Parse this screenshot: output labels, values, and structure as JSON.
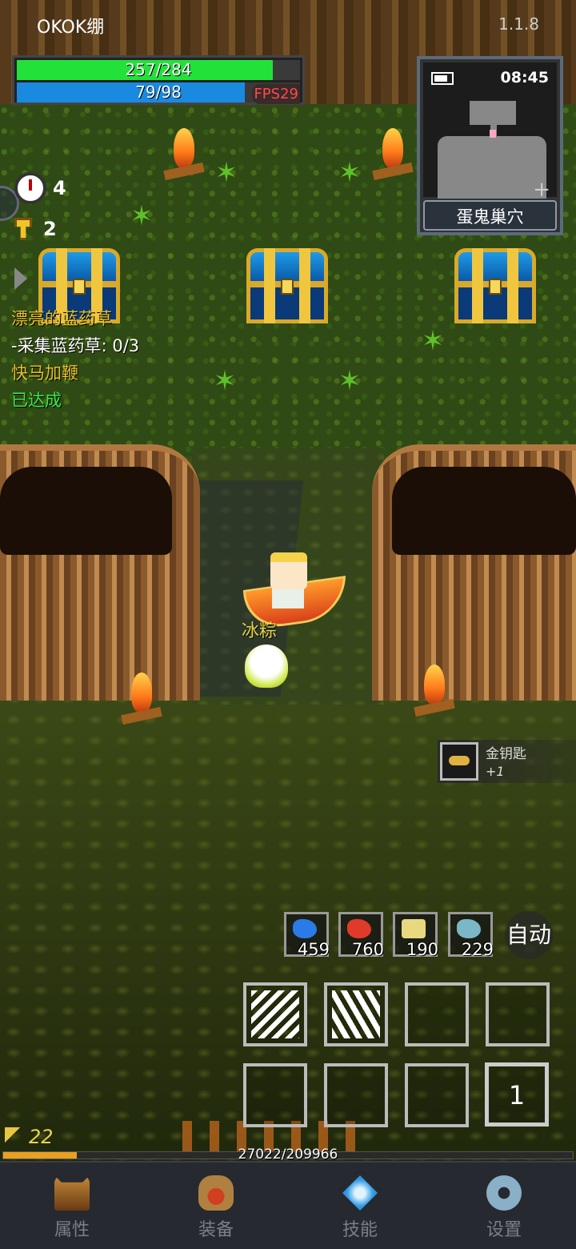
{
  "header": {
    "player_name": "OKOK绷",
    "version": "1.1.8"
  },
  "vitals": {
    "hp": "257/284",
    "hp_fraction": 0.905,
    "mp": "79/98",
    "mp_fraction": 0.806,
    "fps": "FPS29"
  },
  "minimap": {
    "clock": "08:45",
    "zoom_symbol": "+",
    "location": "蛋鬼巢穴"
  },
  "counters": {
    "timer": "4",
    "keys": "2"
  },
  "quest": {
    "title": "漂亮的蓝药草",
    "task": "-采集蓝药草: 0/3",
    "bonus": "快马加鞭",
    "status": "已达成"
  },
  "pet": {
    "name": "冰粽"
  },
  "loot_notice": {
    "item": "金钥匙",
    "count": "+1"
  },
  "potions": [
    {
      "icon": "blue-fish-icon",
      "count": "459",
      "color": "#2a7ae8"
    },
    {
      "icon": "red-fish-icon",
      "count": "760",
      "color": "#e03a2a"
    },
    {
      "icon": "bottles-icon",
      "count": "190",
      "color": "#e8d880"
    },
    {
      "icon": "fish-icon",
      "count": "229",
      "color": "#7ab8c8"
    }
  ],
  "auto_label": "自动",
  "skills": {
    "bag_count": "1"
  },
  "progress": {
    "level": "22",
    "exp": "27022/209966",
    "exp_fraction": 0.129
  },
  "nav": [
    {
      "label": "属性",
      "icon": "helmet-icon"
    },
    {
      "label": "装备",
      "icon": "bag-icon"
    },
    {
      "label": "技能",
      "icon": "gem-icon"
    },
    {
      "label": "设置",
      "icon": "gear-icon"
    }
  ]
}
